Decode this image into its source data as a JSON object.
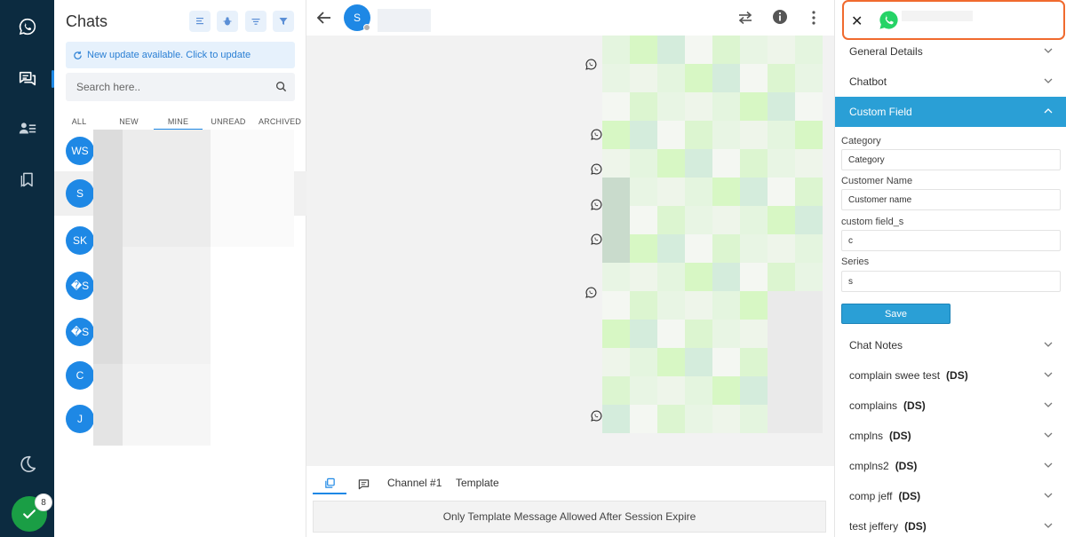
{
  "chatlist": {
    "title": "Chats",
    "update_banner": "New update available. Click to update",
    "search_placeholder": "Search here..",
    "tabs": [
      "ALL",
      "NEW",
      "MINE",
      "UNREAD",
      "ARCHIVED"
    ],
    "active_tab": "MINE",
    "contacts": [
      {
        "initials": "WS"
      },
      {
        "initials": "S"
      },
      {
        "initials": "SK"
      },
      {
        "initials": "�S"
      },
      {
        "initials": "�S"
      },
      {
        "initials": "C"
      },
      {
        "initials": "J"
      }
    ]
  },
  "rail": {
    "status_badge_count": "8"
  },
  "conversation": {
    "avatar_initial": "S",
    "footer_tabs": [
      "Channel #1",
      "Template"
    ],
    "session_notice": "Only Template Message Allowed After Session Expire"
  },
  "panel": {
    "close_label": "✕",
    "sections": {
      "general": "General Details",
      "chatbot": "Chatbot",
      "custom_field": "Custom Field",
      "chat_notes": "Chat Notes"
    },
    "fields": [
      {
        "label": "Category",
        "value": "Category"
      },
      {
        "label": "Customer Name",
        "value": "Customer name"
      },
      {
        "label": "custom field_s",
        "value": "c"
      },
      {
        "label": "Series",
        "value": "s"
      }
    ],
    "save_label": "Save",
    "notes": [
      {
        "title": "complain swee test",
        "tag": "(DS)"
      },
      {
        "title": "complains",
        "tag": "(DS)"
      },
      {
        "title": "cmplns",
        "tag": "(DS)"
      },
      {
        "title": "cmplns2",
        "tag": "(DS)"
      },
      {
        "title": "comp jeff",
        "tag": "(DS)"
      },
      {
        "title": "test jeffery",
        "tag": "(DS)"
      }
    ]
  },
  "colors": {
    "rail_bg": "#0c2b40",
    "accent": "#1e88e5",
    "section_active": "#2a9fd6",
    "highlight_border": "#f06a2e",
    "whatsapp_green": "#25d366",
    "online_green": "#1a9e45"
  },
  "icons": {
    "rail": [
      "whatsapp-icon",
      "chats-icon",
      "contacts-icon",
      "bookmark-icon",
      "moon-icon",
      "check-icon"
    ],
    "header": [
      "back-arrow-icon",
      "swap-icon",
      "info-icon",
      "more-vertical-icon"
    ]
  }
}
